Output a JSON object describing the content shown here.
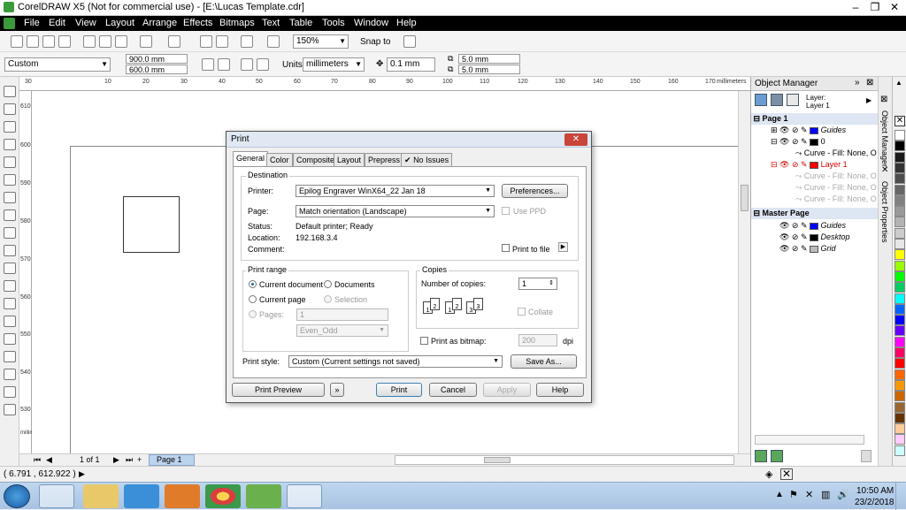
{
  "app": {
    "title": "CorelDRAW X5 (Not for commercial use) - [E:\\Lucas Template.cdr]",
    "window_controls": [
      "–",
      "❐",
      "✕"
    ]
  },
  "menu": [
    "File",
    "Edit",
    "View",
    "Layout",
    "Arrange",
    "Effects",
    "Bitmaps",
    "Text",
    "Table",
    "Tools",
    "Window",
    "Help"
  ],
  "toolbar": {
    "zoom": "150%",
    "snap_to": "Snap to"
  },
  "propbar": {
    "preset": "Custom",
    "width": "900.0 mm",
    "height": "600.0 mm",
    "units_label": "Units:",
    "units": "millimeters",
    "nudge": "0.1 mm",
    "dup_x": "5.0 mm",
    "dup_y": "5.0 mm"
  },
  "ruler": {
    "h_ticks": [
      "30",
      "10",
      "20",
      "30",
      "40",
      "50",
      "60",
      "70",
      "80",
      "90",
      "100",
      "110",
      "120",
      "130",
      "140",
      "150",
      "160",
      "170"
    ],
    "unit": "millimeters",
    "v_ticks": [
      "610",
      "600",
      "590",
      "580",
      "570",
      "560",
      "550",
      "540",
      "530"
    ],
    "v_unit": "millimeters"
  },
  "pagenav": {
    "counter": "1 of 1",
    "page_tab": "Page 1"
  },
  "status": {
    "coords": "( 6.791 , 612.922 )"
  },
  "object_manager": {
    "title": "Object Manager",
    "layer_info_1": "Layer:",
    "layer_info_2": "Layer 1",
    "rows": [
      {
        "text": "Page 1",
        "type": "section"
      },
      {
        "text": "Guides",
        "type": "layer",
        "color": "#0000ff",
        "italic": true
      },
      {
        "text": "0",
        "type": "layer",
        "color": "#000000",
        "italic": false
      },
      {
        "text": "Curve - Fill: None, O",
        "type": "object",
        "italic": false
      },
      {
        "text": "Layer 1",
        "type": "layer",
        "color": "#ff0000",
        "italic": false,
        "red": true
      },
      {
        "text": "Curve - Fill: None, O",
        "type": "object",
        "gray": true
      },
      {
        "text": "Curve - Fill: None, O",
        "type": "object",
        "gray": true
      },
      {
        "text": "Curve - Fill: None, O",
        "type": "object",
        "gray": true
      },
      {
        "text": "Master Page",
        "type": "section"
      },
      {
        "text": "Guides",
        "type": "layer",
        "color": "#0000ff",
        "italic": true
      },
      {
        "text": "Desktop",
        "type": "layer",
        "color": "#000000",
        "italic": true
      },
      {
        "text": "Grid",
        "type": "layer",
        "color": "#bbbbbb",
        "italic": true
      }
    ]
  },
  "side_tabs": [
    "Object Manager",
    "Object Properties"
  ],
  "palette": [
    "#ffffff",
    "#000000",
    "#1a1a1a",
    "#333333",
    "#4d4d4d",
    "#666666",
    "#808080",
    "#999999",
    "#b3b3b3",
    "#cccccc",
    "#e6e6e6",
    "#ffff00",
    "#99ff00",
    "#00ff00",
    "#00cc66",
    "#00ffff",
    "#0066ff",
    "#0000ff",
    "#6600ff",
    "#ff00ff",
    "#ff0066",
    "#ff0000",
    "#ff6600",
    "#ff9900",
    "#cc6600",
    "#996633",
    "#663300",
    "#ffcc99",
    "#ffccff",
    "#ccffff"
  ],
  "dialog": {
    "title": "Print",
    "tabs": [
      "General",
      "Color",
      "Composite",
      "Layout",
      "Prepress",
      "No Issues"
    ],
    "destination": {
      "label": "Destination",
      "printer_label": "Printer:",
      "printer": "Epilog Engraver WinX64_22 Jan 18",
      "preferences": "Preferences...",
      "page_label": "Page:",
      "page": "Match orientation (Landscape)",
      "use_ppd": "Use PPD",
      "status_label": "Status:",
      "status": "Default printer; Ready",
      "location_label": "Location:",
      "location": "192.168.3.4",
      "comment_label": "Comment:",
      "print_to_file": "Print to file"
    },
    "print_range": {
      "label": "Print range",
      "current_document": "Current document",
      "documents": "Documents",
      "current_page": "Current page",
      "selection": "Selection",
      "pages": "Pages:",
      "pages_value": "1",
      "even_odd": "Even_Odd"
    },
    "copies": {
      "label": "Copies",
      "number_label": "Number of copies:",
      "number": "1",
      "collate": "Collate"
    },
    "print_as_bitmap": "Print as bitmap:",
    "dpi_value": "200",
    "dpi": "dpi",
    "print_style_label": "Print style:",
    "print_style": "Custom (Current settings not saved)",
    "save_as": "Save As...",
    "buttons": {
      "preview": "Print Preview",
      "print": "Print",
      "cancel": "Cancel",
      "apply": "Apply",
      "help": "Help"
    }
  },
  "taskbar": {
    "time": "10:50 AM",
    "date": "23/2/2018"
  }
}
